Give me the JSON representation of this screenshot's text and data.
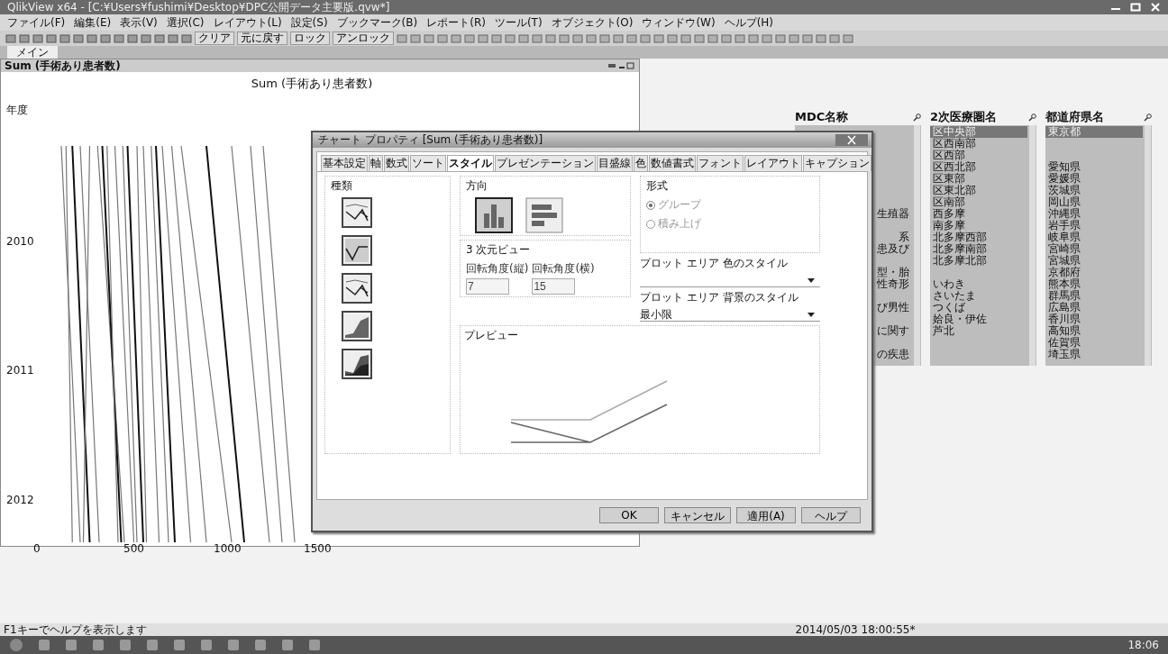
{
  "window": {
    "title": "QlikView x64 - [C:¥Users¥fushimi¥Desktop¥DPC公開データ主要版.qvw*]"
  },
  "menu": [
    "ファイル(F)",
    "編集(E)",
    "表示(V)",
    "選択(C)",
    "レイアウト(L)",
    "設定(S)",
    "ブックマーク(B)",
    "レポート(R)",
    "ツール(T)",
    "オブジェクト(O)",
    "ウィンドウ(W)",
    "ヘルプ(H)"
  ],
  "toolbar": {
    "buttons": [
      "クリア",
      "元に戻す",
      "ロック",
      "アンロック"
    ]
  },
  "sheet_tabs": [
    {
      "label": "メイン",
      "selected": true
    }
  ],
  "chart_panel": {
    "caption": "Sum (手術あり患者数)",
    "title": "Sum (手術あり患者数)",
    "y_axis_title": "年度",
    "y_labels": [
      "2010",
      "2011",
      "2012"
    ],
    "x_labels": [
      "0",
      "500",
      "1000",
      "1500"
    ]
  },
  "listboxes": [
    {
      "title": "MDC名称",
      "covered_left": true,
      "items": [
        {
          "kind": "blank"
        },
        {
          "kind": "blank"
        },
        {
          "kind": "blank"
        },
        {
          "kind": "blank"
        },
        {
          "kind": "blank"
        },
        {
          "kind": "blank"
        },
        {
          "kind": "blank"
        },
        {
          "kind": "item",
          "label": "生殖器",
          "selected": false
        },
        {
          "kind": "blank"
        },
        {
          "kind": "item",
          "label": "系",
          "selected": false
        },
        {
          "kind": "item",
          "label": "患及び",
          "selected": false
        },
        {
          "kind": "blank"
        },
        {
          "kind": "item",
          "label": "型・胎",
          "selected": false
        },
        {
          "kind": "item",
          "label": "性奇形",
          "selected": false
        },
        {
          "kind": "blank"
        },
        {
          "kind": "item",
          "label": "び男性",
          "selected": false
        },
        {
          "kind": "blank"
        },
        {
          "kind": "item",
          "label": "に関す",
          "selected": false
        },
        {
          "kind": "blank"
        },
        {
          "kind": "item",
          "label": "の疾患",
          "selected": false
        }
      ]
    },
    {
      "title": "2次医療圏名",
      "covered_left": false,
      "items": [
        {
          "kind": "item",
          "label": "区中央部",
          "selected": true
        },
        {
          "kind": "item",
          "label": "区西南部",
          "selected": false
        },
        {
          "kind": "item",
          "label": "区西部",
          "selected": false
        },
        {
          "kind": "item",
          "label": "区西北部",
          "selected": false
        },
        {
          "kind": "item",
          "label": "区東部",
          "selected": false
        },
        {
          "kind": "item",
          "label": "区東北部",
          "selected": false
        },
        {
          "kind": "item",
          "label": "区南部",
          "selected": false
        },
        {
          "kind": "item",
          "label": "西多摩",
          "selected": false
        },
        {
          "kind": "item",
          "label": "南多摩",
          "selected": false
        },
        {
          "kind": "item",
          "label": "北多摩西部",
          "selected": false
        },
        {
          "kind": "item",
          "label": "北多摩南部",
          "selected": false
        },
        {
          "kind": "item",
          "label": "北多摩北部",
          "selected": false
        },
        {
          "kind": "blank"
        },
        {
          "kind": "item",
          "label": "いわき",
          "selected": false
        },
        {
          "kind": "item",
          "label": "さいたま",
          "selected": false
        },
        {
          "kind": "item",
          "label": "つくば",
          "selected": false
        },
        {
          "kind": "item",
          "label": "姶良・伊佐",
          "selected": false
        },
        {
          "kind": "item",
          "label": "芦北",
          "selected": false
        }
      ]
    },
    {
      "title": "都道府県名",
      "covered_left": false,
      "items": [
        {
          "kind": "item",
          "label": "東京都",
          "selected": true
        },
        {
          "kind": "blank"
        },
        {
          "kind": "blank"
        },
        {
          "kind": "item",
          "label": "愛知県",
          "selected": false
        },
        {
          "kind": "item",
          "label": "愛媛県",
          "selected": false
        },
        {
          "kind": "item",
          "label": "茨城県",
          "selected": false
        },
        {
          "kind": "item",
          "label": "岡山県",
          "selected": false
        },
        {
          "kind": "item",
          "label": "沖縄県",
          "selected": false
        },
        {
          "kind": "item",
          "label": "岩手県",
          "selected": false
        },
        {
          "kind": "item",
          "label": "岐阜県",
          "selected": false
        },
        {
          "kind": "item",
          "label": "宮崎県",
          "selected": false
        },
        {
          "kind": "item",
          "label": "宮城県",
          "selected": false
        },
        {
          "kind": "item",
          "label": "京都府",
          "selected": false
        },
        {
          "kind": "item",
          "label": "熊本県",
          "selected": false
        },
        {
          "kind": "item",
          "label": "群馬県",
          "selected": false
        },
        {
          "kind": "item",
          "label": "広島県",
          "selected": false
        },
        {
          "kind": "item",
          "label": "香川県",
          "selected": false
        },
        {
          "kind": "item",
          "label": "高知県",
          "selected": false
        },
        {
          "kind": "item",
          "label": "佐賀県",
          "selected": false
        },
        {
          "kind": "item",
          "label": "埼玉県",
          "selected": false
        }
      ]
    }
  ],
  "dialog": {
    "title": "チャート プロパティ [Sum (手術あり患者数)]",
    "tabs": [
      {
        "label": "基本設定",
        "selected": false
      },
      {
        "label": "軸",
        "selected": false
      },
      {
        "label": "数式",
        "selected": false
      },
      {
        "label": "ソート",
        "selected": false
      },
      {
        "label": "スタイル",
        "selected": true
      },
      {
        "label": "プレゼンテーション",
        "selected": false
      },
      {
        "label": "目盛線",
        "selected": false
      },
      {
        "label": "色",
        "selected": false
      },
      {
        "label": "数値書式",
        "selected": false
      },
      {
        "label": "フォント",
        "selected": false
      },
      {
        "label": "レイアウト",
        "selected": false
      },
      {
        "label": "キャプション",
        "selected": false
      }
    ],
    "type_group": {
      "label": "種類",
      "types": [
        {
          "kind": "combo"
        },
        {
          "kind": "line"
        },
        {
          "kind": "combo"
        },
        {
          "kind": "area"
        },
        {
          "kind": "stacked-area"
        }
      ]
    },
    "orientation_group": {
      "label": "方向",
      "options": [
        {
          "kind": "vertical",
          "selected": true
        },
        {
          "kind": "horizontal",
          "selected": false
        }
      ]
    },
    "format_group": {
      "label": "形式",
      "options": [
        {
          "label": "グループ",
          "selected": true,
          "disabled": true
        },
        {
          "label": "積み上げ",
          "selected": false,
          "disabled": true
        }
      ]
    },
    "view3d_group": {
      "label": "3 次元ビュー",
      "fields": [
        {
          "label": "回転角度(縦)",
          "value": "7",
          "disabled": true
        },
        {
          "label": "回転角度(横)",
          "value": "15",
          "disabled": true
        }
      ]
    },
    "plot_color": {
      "label": "プロット エリア 色のスタイル"
    },
    "plot_background": {
      "label": "プロット エリア 背景のスタイル",
      "value": "最小限"
    },
    "preview_label": "プレビュー",
    "buttons": [
      "OK",
      "キャンセル",
      "適用(A)",
      "ヘルプ"
    ]
  },
  "status_bar": {
    "hint": "F1キーでヘルプを表示します",
    "timestamp": "2014/05/03 18:00:55*"
  },
  "taskbar": {
    "clock": "18:06"
  }
}
